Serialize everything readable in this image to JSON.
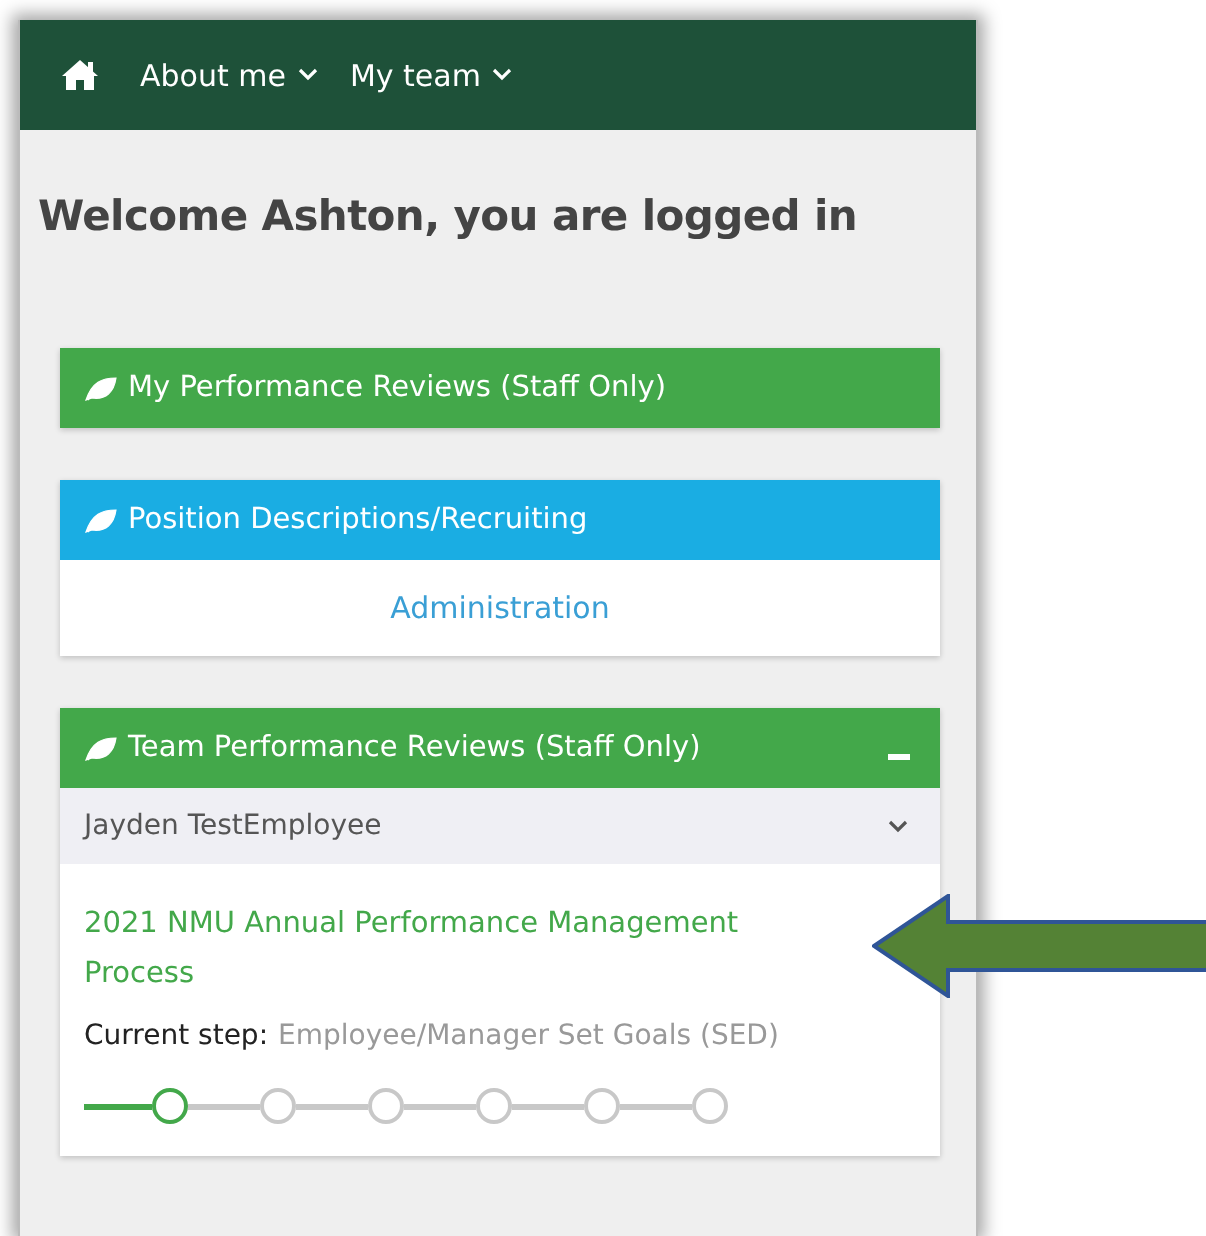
{
  "nav": {
    "items": [
      {
        "label": "About me",
        "has_menu": true
      },
      {
        "label": "My team",
        "has_menu": true
      }
    ]
  },
  "heading": "Welcome Ashton, you are logged in",
  "panels": [
    {
      "title": "My Performance Reviews (Staff Only)",
      "color": "#43a84a"
    },
    {
      "title": "Position Descriptions/Recruiting",
      "color": "#1aade3",
      "link": "Administration"
    },
    {
      "title": "Team Performance Reviews (Staff Only)",
      "color": "#43a84a",
      "expanded": true,
      "employee": "Jayden TestEmployee",
      "process": "2021 NMU Annual Performance Management Process",
      "step_label": "Current step:",
      "step": "Employee/Manager Set Goals (SED)",
      "steps": [
        {
          "selected": true
        },
        {
          "selected": false
        },
        {
          "selected": false
        },
        {
          "selected": false
        },
        {
          "selected": false
        },
        {
          "selected": false
        }
      ]
    }
  ]
}
